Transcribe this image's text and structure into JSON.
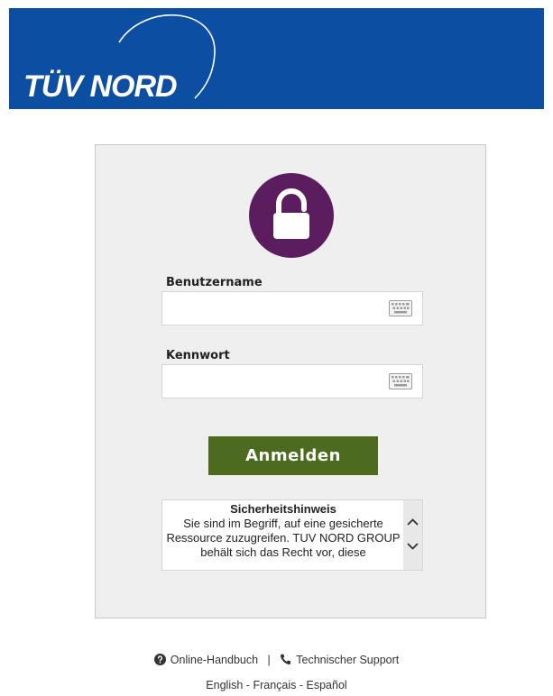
{
  "header": {
    "logo_text": "TÜV NORD",
    "background_color": "#0b4ea2"
  },
  "login": {
    "lock_icon": "lock-icon",
    "accent_color": "#5c1d5f",
    "username_label": "Benutzername",
    "username_value": "",
    "password_label": "Kennwort",
    "password_value": "",
    "keyboard_icon": "keyboard-icon",
    "submit_label": "Anmelden",
    "submit_color": "#4d6b1f"
  },
  "notice": {
    "title": "Sicherheitshinweis",
    "text": "Sie sind im Begriff, auf eine gesicherte Ressource zuzugreifen. TUV NORD GROUP behält sich das Recht vor, diese"
  },
  "footer": {
    "manual_label": "Online-Handbuch",
    "manual_icon": "help-circle-icon",
    "separator": "|",
    "support_label": "Technischer Support",
    "support_icon": "phone-icon",
    "languages": [
      "English",
      "Français",
      "Español"
    ],
    "language_separator": "-"
  }
}
